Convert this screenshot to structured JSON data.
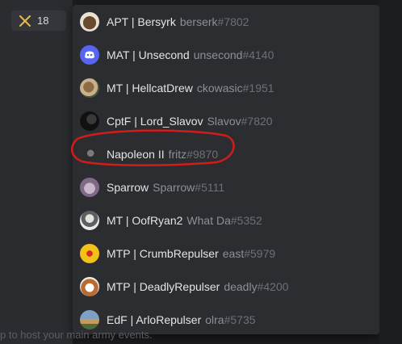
{
  "role": {
    "count": "18",
    "icon": "crossed-swords-icon",
    "color": "#e8b84a"
  },
  "background": {
    "bottom_text": "p to host your main army events."
  },
  "members": [
    {
      "display": "APT | Bersyrk",
      "username": "berserk",
      "discrim": "#7802",
      "avatar": "bison-avatar"
    },
    {
      "display": "MAT | Unsecond",
      "username": "unsecond",
      "discrim": "#4140",
      "avatar": "discord-default-avatar"
    },
    {
      "display": "MT | HellcatDrew",
      "username": "ckowasic",
      "discrim": "#1951",
      "avatar": "dog-avatar"
    },
    {
      "display": "CptF | Lord_Slavov",
      "username": "Slavov",
      "discrim": "#7820",
      "avatar": "dark-figure-avatar"
    },
    {
      "display": "Napoleon II",
      "username": "fritz",
      "discrim": "#9870",
      "avatar": "portrait-avatar"
    },
    {
      "display": "Sparrow",
      "username": "Sparrow",
      "discrim": "#5111",
      "avatar": "cat-avatar"
    },
    {
      "display": "MT | OofRyan2",
      "username": "What Da",
      "discrim": "#5352",
      "avatar": "person-avatar"
    },
    {
      "display": "MTP | CrumbRepulser",
      "username": "east",
      "discrim": "#5979",
      "avatar": "yellow-badge-avatar"
    },
    {
      "display": "MTP | DeadlyRepulser",
      "username": "deadly",
      "discrim": "#4200",
      "avatar": "dog-face-avatar"
    },
    {
      "display": "EdF | ArloRepulser",
      "username": "olra",
      "discrim": "#5735",
      "avatar": "landscape-avatar"
    }
  ],
  "annotation": {
    "color": "#d21c1c",
    "target": "Napoleon II"
  }
}
